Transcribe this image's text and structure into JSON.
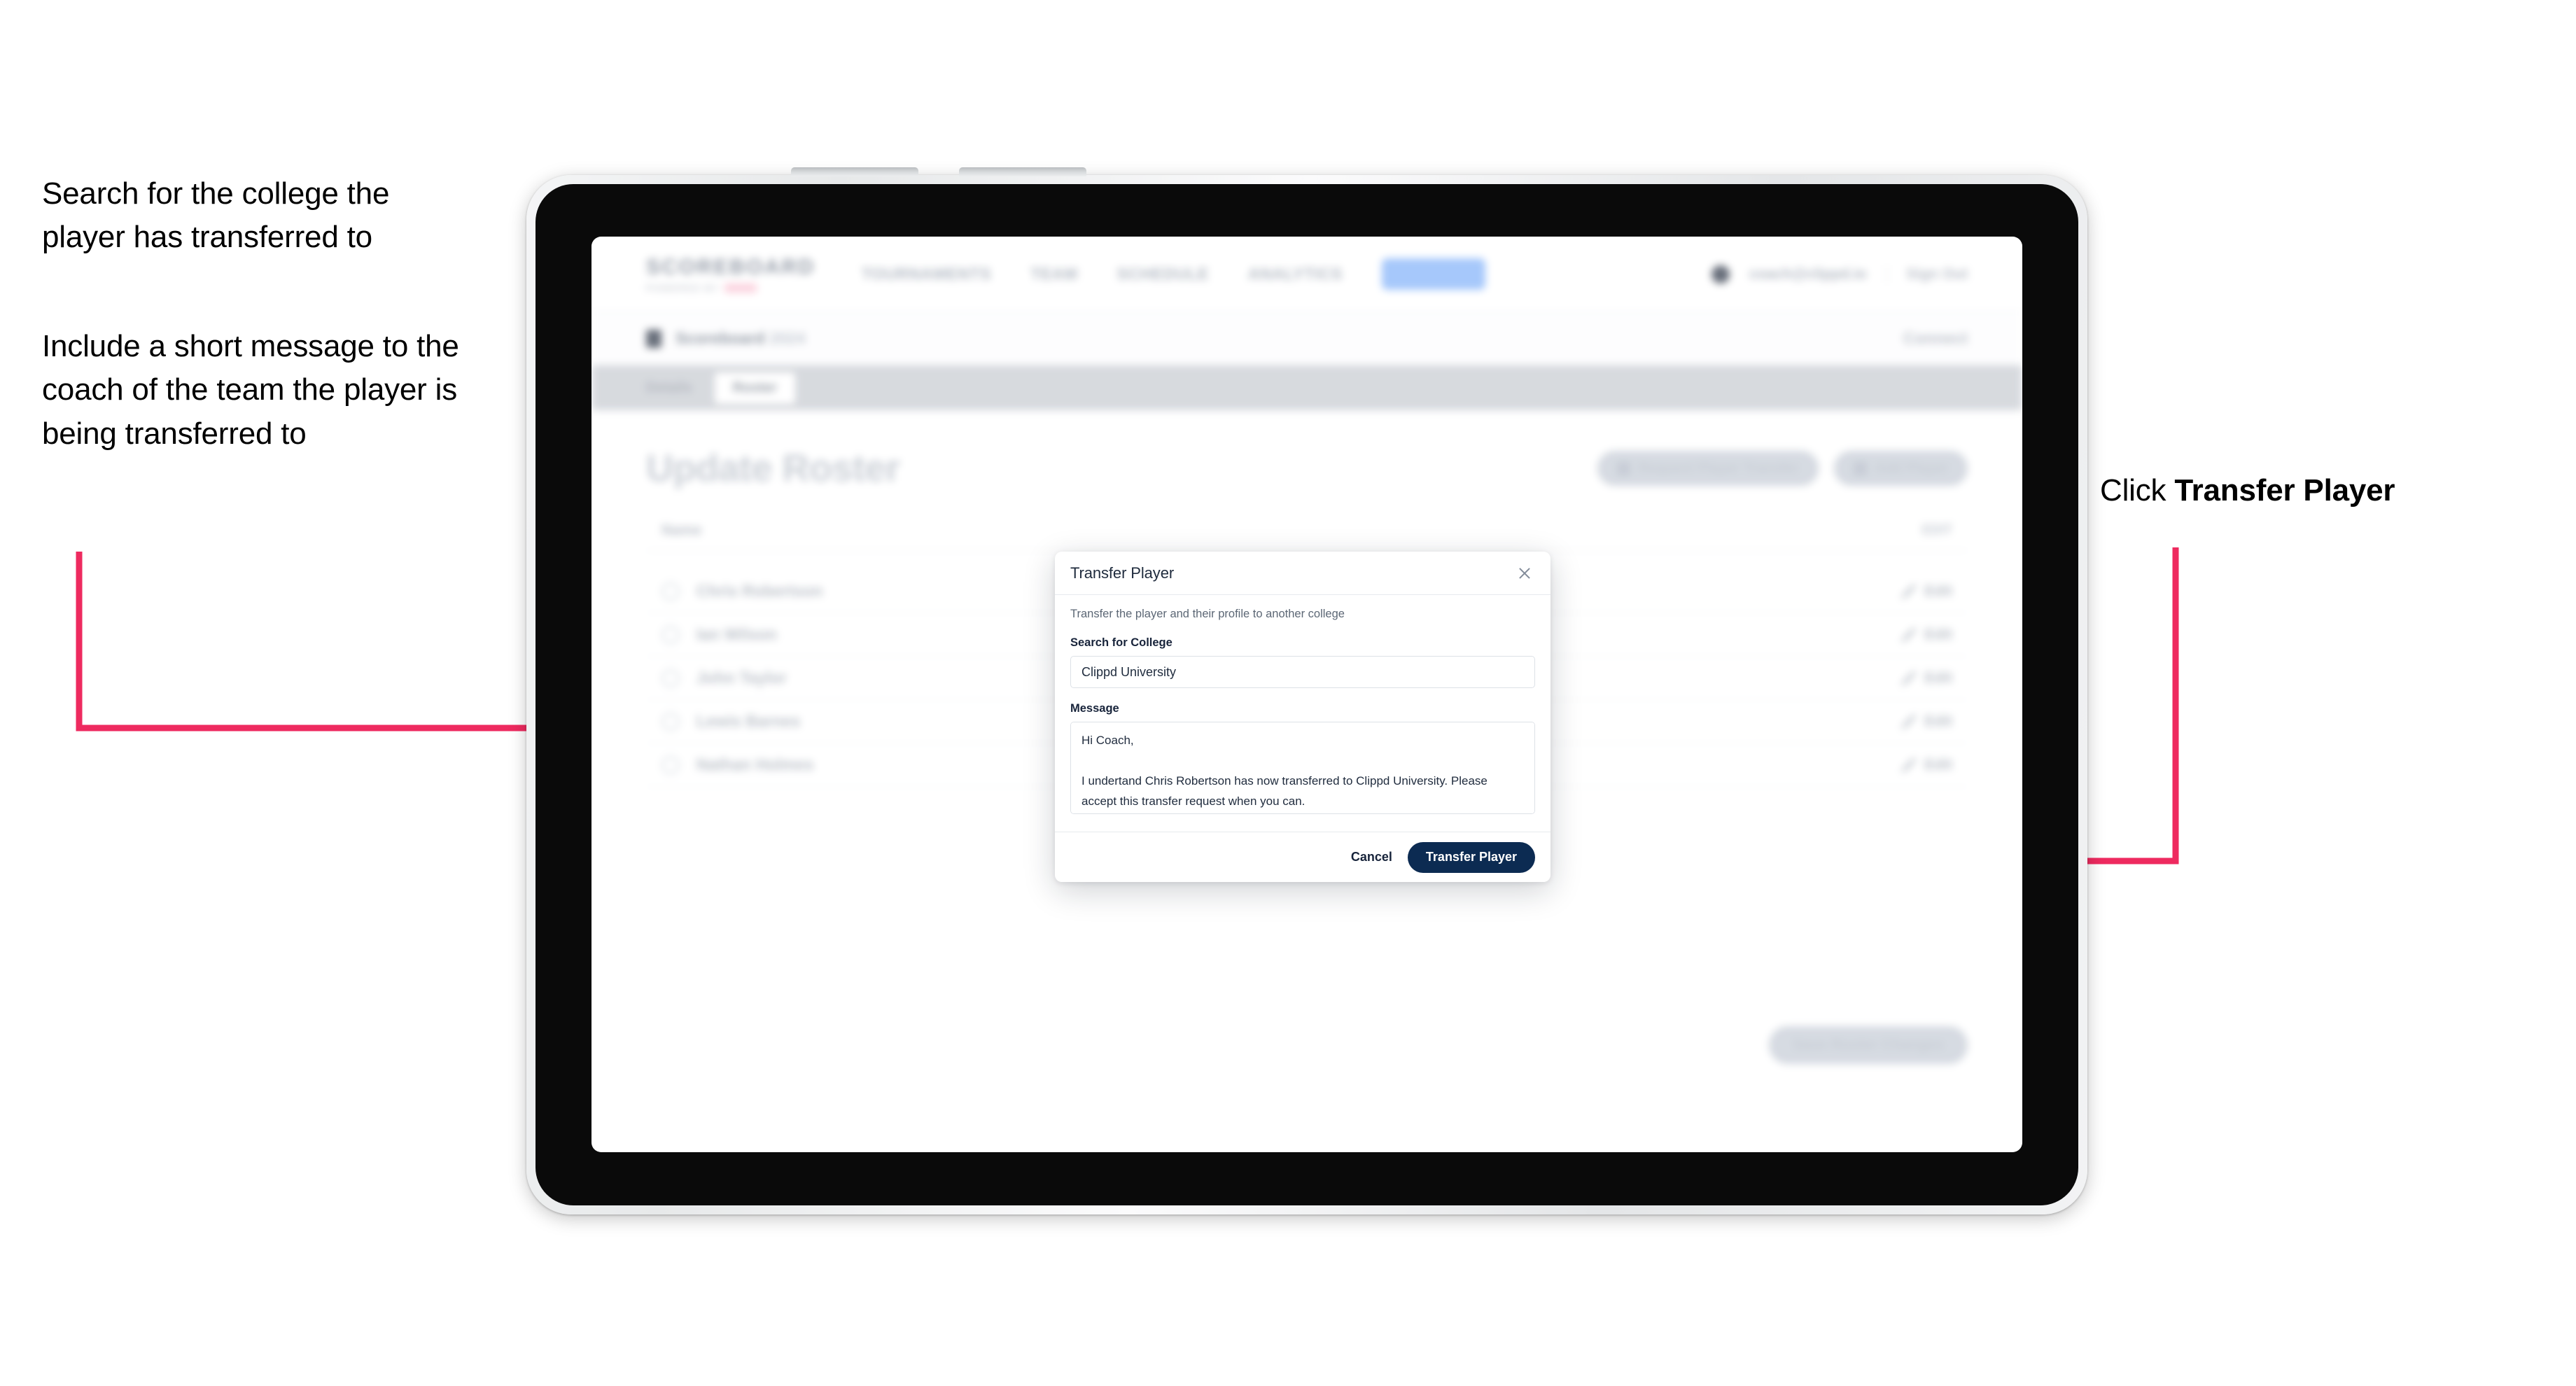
{
  "annotations": {
    "left_1": "Search for the college the player has transferred to",
    "left_2": "Include a short message to the coach of the team the player is being transferred to",
    "right_1_prefix": "Click ",
    "right_1_bold": "Transfer Player"
  },
  "colors": {
    "arrow_pink": "#ee2a5f",
    "modal_primary": "#0c2b52",
    "device_bezel": "#0a0a0a"
  },
  "app": {
    "brand": {
      "name": "SCOREBOARD",
      "subtitle": "POWERED BY"
    },
    "nav_links": [
      "TOURNAMENTS",
      "TEAM",
      "SCHEDULE",
      "ANALYTICS"
    ],
    "nav_pill": "ROSTER",
    "user": {
      "name": "coach@clippd.io",
      "sign_out": "Sign Out"
    },
    "breadcrumb": {
      "text": "Scoreboard",
      "muted": " 2024",
      "right": "Connect"
    },
    "tabs": [
      {
        "label": "Details",
        "active": false
      },
      {
        "label": "Roster",
        "active": true
      }
    ],
    "page_title": "Update Roster",
    "page_actions": [
      {
        "label": "Request Player Transfer",
        "icon": "transfer-icon"
      },
      {
        "label": "Add Player",
        "icon": "plus-icon"
      }
    ],
    "list_header": {
      "name": "Name",
      "right": "EDIT"
    },
    "players": [
      {
        "name": "Chris Robertson",
        "action": "Edit"
      },
      {
        "name": "Ian Wilson",
        "action": "Edit"
      },
      {
        "name": "John Taylor",
        "action": "Edit"
      },
      {
        "name": "Lewis Barnes",
        "action": "Edit"
      },
      {
        "name": "Nathan Holmes",
        "action": "Edit"
      }
    ],
    "bottom_cta": "Save Roster Changes"
  },
  "modal": {
    "title": "Transfer Player",
    "close_icon": "close-icon",
    "description": "Transfer the player and their profile to another college",
    "college_label": "Search for College",
    "college_value": "Clippd University",
    "college_placeholder": "Search for College",
    "message_label": "Message",
    "message_value": "Hi Coach,\n\nI undertand Chris Robertson has now transferred to Clippd University. Please accept this transfer request when you can.",
    "message_placeholder": "Message",
    "cancel_label": "Cancel",
    "submit_label": "Transfer Player"
  }
}
